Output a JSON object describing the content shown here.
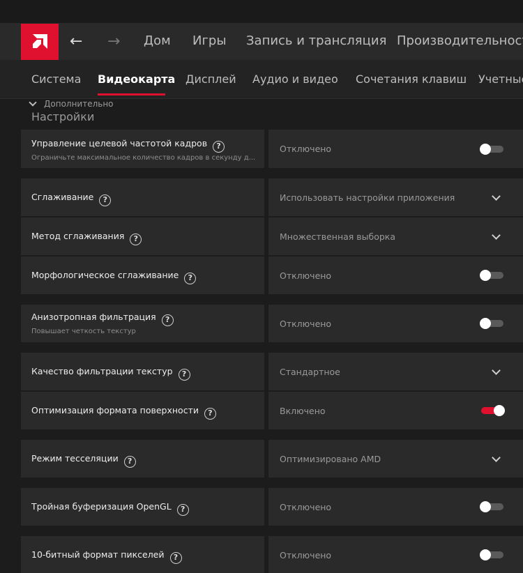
{
  "nav": {
    "items": [
      "Дом",
      "Игры",
      "Запись и трансляция",
      "Производительность"
    ]
  },
  "tabs": [
    "Система",
    "Видеокарта",
    "Дисплей",
    "Аудио и видео",
    "Сочетания клавиш",
    "Учетные"
  ],
  "advanced_label": "Дополнительно",
  "section_title": "Настройки",
  "settings": [
    {
      "title": "Управление целевой частотой кадров",
      "subtitle": "Ограничьте максимальное количество кадров в секунду д...",
      "value": "Отключено",
      "control": "toggle",
      "state": "off"
    },
    {
      "title": "Сглаживание",
      "value": "Использовать настройки приложения",
      "control": "dropdown"
    },
    {
      "title": "Метод сглаживания",
      "value": "Множественная выборка",
      "control": "dropdown"
    },
    {
      "title": "Морфологическое сглаживание",
      "value": "Отключено",
      "control": "toggle",
      "state": "off"
    },
    {
      "title": "Анизотропная фильтрация",
      "subtitle": "Повышает четкость текстур",
      "value": "Отключено",
      "control": "toggle",
      "state": "off"
    },
    {
      "title": "Качество фильтрации текстур",
      "value": "Стандартное",
      "control": "dropdown"
    },
    {
      "title": "Оптимизация формата поверхности",
      "value": "Включено",
      "control": "toggle",
      "state": "on"
    },
    {
      "title": "Режим тесселяции",
      "value": "Оптимизировано AMD",
      "control": "dropdown"
    },
    {
      "title": "Тройная буферизация OpenGL",
      "value": "Отключено",
      "control": "toggle",
      "state": "off"
    },
    {
      "title": "10-битный формат пикселей",
      "value": "Отключено",
      "control": "toggle",
      "state": "off"
    }
  ],
  "colors": {
    "accent": "#e0102f",
    "panel": "#2a2a2a",
    "background": "#1c1c1c"
  }
}
